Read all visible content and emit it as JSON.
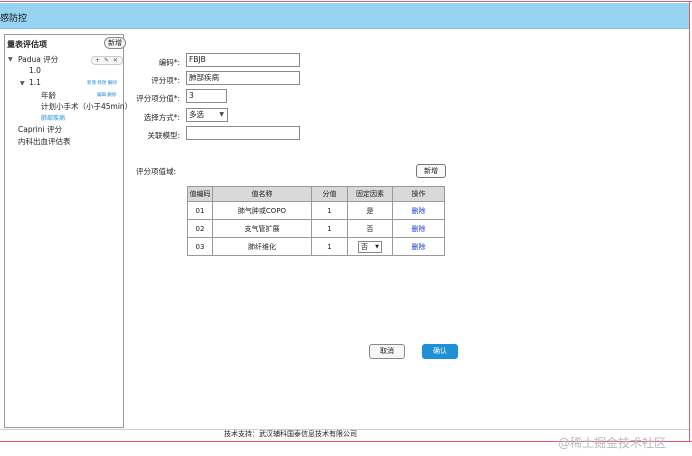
{
  "header": {
    "title": "感防控"
  },
  "sidebar": {
    "title": "量表评估项",
    "add_label": "新增",
    "padua": {
      "label": "Padua 评分",
      "tools": "+ ✎ ✕"
    },
    "v1_0": {
      "label": "1.0"
    },
    "v1_1": {
      "label": "1.1",
      "actions": "新增 修改 删除"
    },
    "age": {
      "label": "年龄",
      "actions": "编辑 删除"
    },
    "surgery": {
      "label": "计划小手术（小于45min）"
    },
    "lung": {
      "label": "肺部疾病"
    },
    "caprini": {
      "label": "Caprini 评分"
    },
    "bleeding": {
      "label": "内科出血评估表"
    }
  },
  "form": {
    "code": {
      "label": "编码*:",
      "value": "FBJB"
    },
    "item": {
      "label": "评分项*:",
      "value": "肺部疾病"
    },
    "score": {
      "label": "评分项分值*:",
      "value": "3"
    },
    "mode": {
      "label": "选择方式*:",
      "value": "多选"
    },
    "model": {
      "label": "关联模型:",
      "value": ""
    }
  },
  "domain": {
    "label": "评分项值域:",
    "add_label": "新增",
    "columns": [
      "值编码",
      "值名称",
      "分值",
      "固定因素",
      "操作"
    ],
    "rows": [
      {
        "code": "01",
        "name": "肺气肿或COPO",
        "score": "1",
        "fixed": "是",
        "action": "删除"
      },
      {
        "code": "02",
        "name": "支气管扩展",
        "score": "1",
        "fixed": "否",
        "action": "删除"
      },
      {
        "code": "03",
        "name": "肺纤维化",
        "score": "1",
        "fixed": "否",
        "action": "删除"
      }
    ]
  },
  "buttons": {
    "cancel": "取消",
    "confirm": "确认"
  },
  "footer": {
    "text": "技术支持：武汉辅科国泰信息技术有限公司"
  },
  "watermark": {
    "text": "@稀土掘金技术社区"
  },
  "colors": {
    "header_bg": "#96d4f2",
    "primary": "#1e90d6",
    "link": "#1a3fd8",
    "frame": "#e05a6e"
  }
}
